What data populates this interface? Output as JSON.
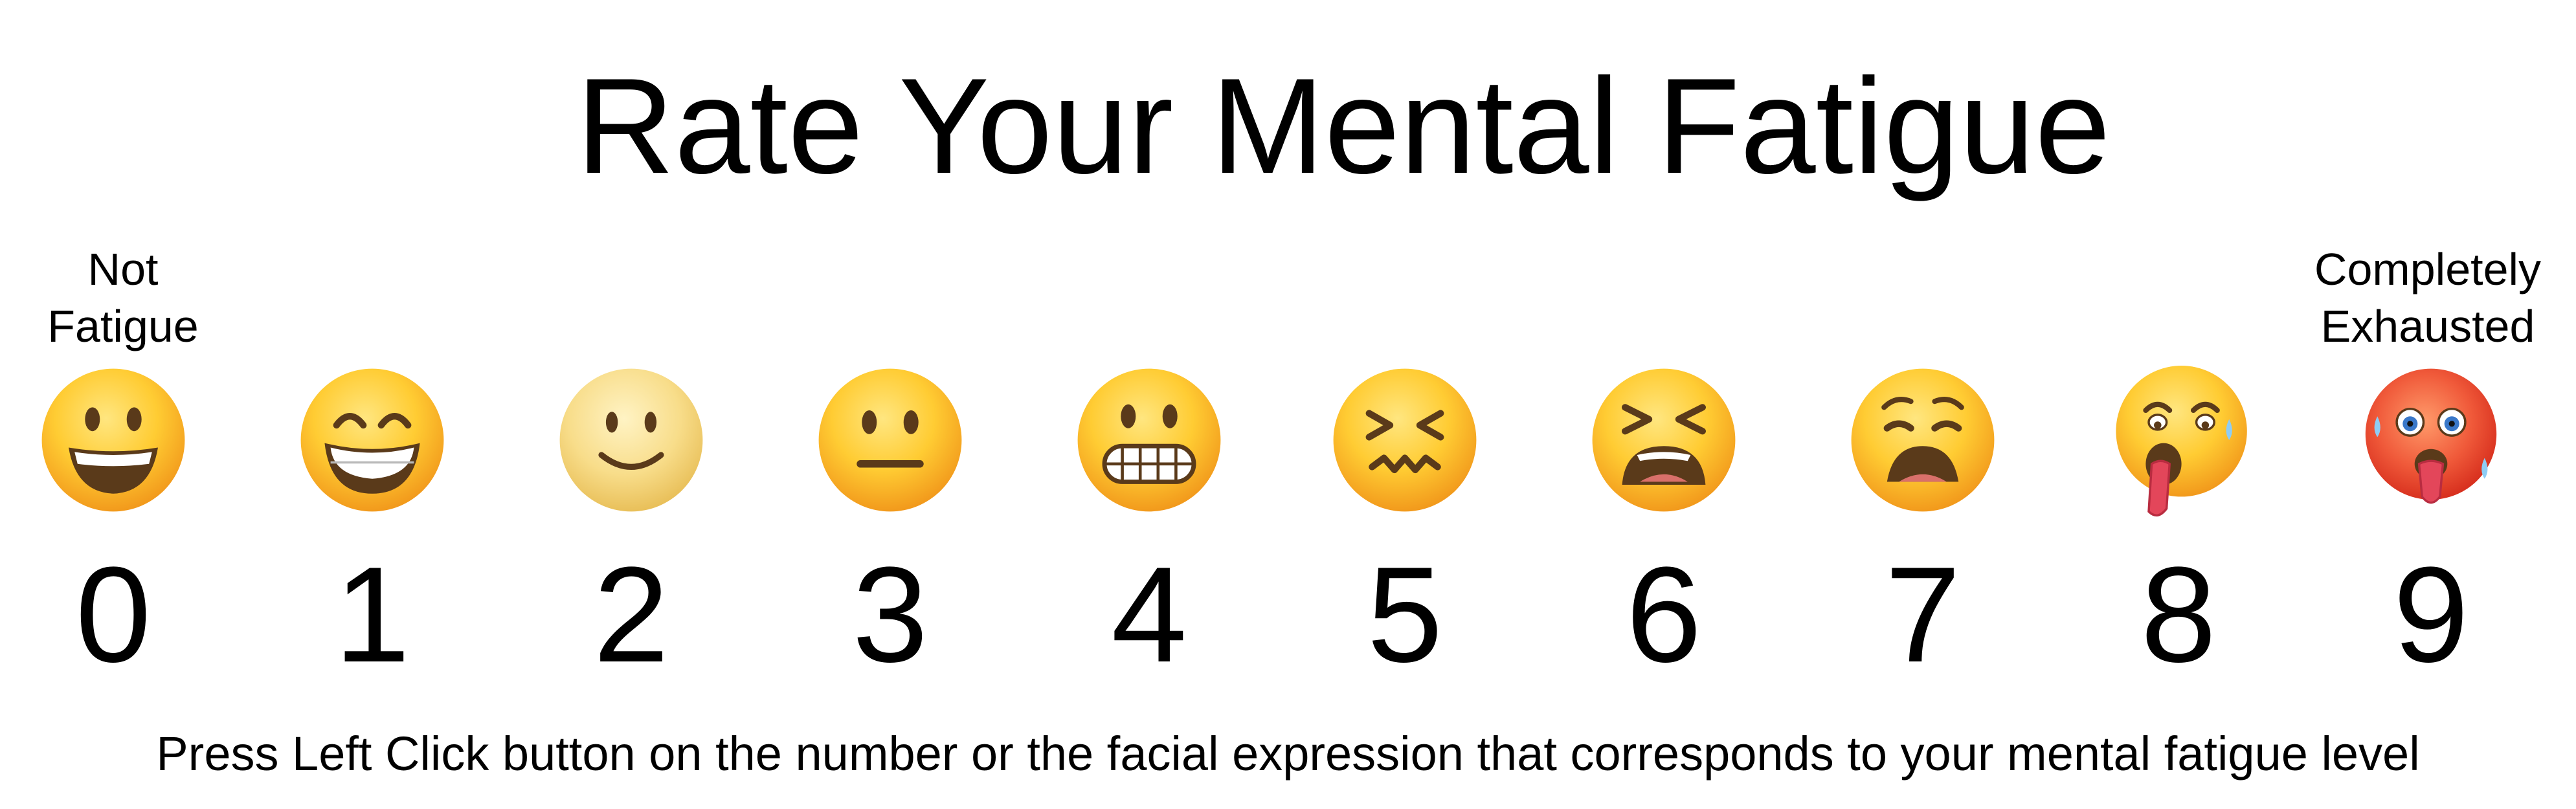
{
  "title": "Rate Your Mental Fatigue",
  "anchors": {
    "low": "Not Fatigue",
    "high": "Completely Exhausted"
  },
  "scale": [
    {
      "value": "0",
      "icon": "grinning-face-icon"
    },
    {
      "value": "1",
      "icon": "beaming-face-icon"
    },
    {
      "value": "2",
      "icon": "slightly-smiling-face-icon"
    },
    {
      "value": "3",
      "icon": "neutral-face-icon"
    },
    {
      "value": "4",
      "icon": "grimacing-face-icon"
    },
    {
      "value": "5",
      "icon": "confounded-face-icon"
    },
    {
      "value": "6",
      "icon": "tired-face-icon"
    },
    {
      "value": "7",
      "icon": "weary-face-icon"
    },
    {
      "value": "8",
      "icon": "exhausted-tongue-out-face-icon"
    },
    {
      "value": "9",
      "icon": "hot-face-icon"
    }
  ],
  "instruction": "Press Left Click button on the number or the facial expression that corresponds to your mental fatigue level",
  "colors": {
    "text": "#000000",
    "emoji_yellow": "#FFCC33",
    "emoji_shade": "#F29A1C",
    "emoji_red": "#E8412A",
    "tongue": "#E3465A"
  }
}
